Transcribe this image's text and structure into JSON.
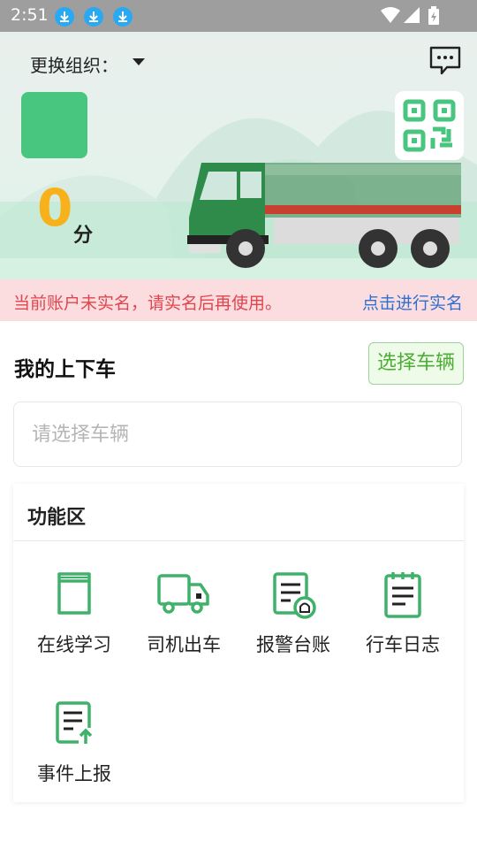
{
  "status_bar": {
    "time": "2:51"
  },
  "header": {
    "org_label": "更换组织：",
    "score_value": "0",
    "score_unit": "分"
  },
  "notice": {
    "text": "当前账户未实名，请实名后再使用。",
    "link": "点击进行实名"
  },
  "vehicle": {
    "section_title": "我的上下车",
    "select_button": "选择车辆",
    "input_placeholder": "请选择车辆"
  },
  "functions": {
    "title": "功能区",
    "items": [
      {
        "label": "在线学习",
        "icon": "book-icon"
      },
      {
        "label": "司机出车",
        "icon": "truck-icon"
      },
      {
        "label": "报警台账",
        "icon": "alarm-ledger-icon"
      },
      {
        "label": "行车日志",
        "icon": "clipboard-icon"
      },
      {
        "label": "事件上报",
        "icon": "report-upload-icon"
      }
    ]
  },
  "colors": {
    "accent_green": "#48c57f",
    "icon_green": "#3fb26a",
    "score_orange": "#f7b21b",
    "notice_red": "#e0454d",
    "notice_link_blue": "#2f6fd0"
  }
}
